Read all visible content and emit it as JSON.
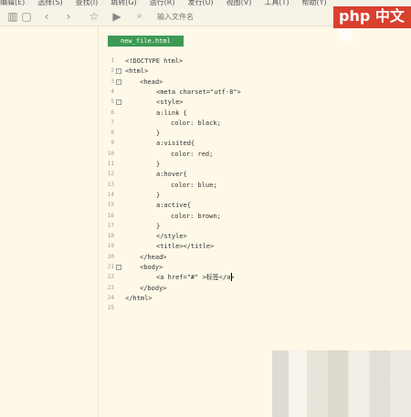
{
  "menubar": [
    "编辑(E)",
    "选择(S)",
    "查找(I)",
    "跳转(G)",
    "运行(R)",
    "发行(U)",
    "视图(V)",
    "工具(T)",
    "帮助(Y)"
  ],
  "toolbar": {
    "search_placeholder": "输入文件名"
  },
  "logo": "php 中文网",
  "tab": {
    "label": "new_file.html"
  },
  "lines": [
    {
      "n": "1",
      "text": "<!DOCTYPE html>",
      "indent": 0,
      "fold": ""
    },
    {
      "n": "2",
      "text": "<html>",
      "indent": 0,
      "fold": "-"
    },
    {
      "n": "3",
      "text": "<head>",
      "indent": 1,
      "fold": "-"
    },
    {
      "n": "4",
      "text": "<meta charset=\"utf-8\">",
      "indent": 2,
      "fold": ""
    },
    {
      "n": "5",
      "text": "<style>",
      "indent": 2,
      "fold": "-"
    },
    {
      "n": "6",
      "text": "a:link {",
      "indent": 2,
      "fold": ""
    },
    {
      "n": "7",
      "text": "color: black;",
      "indent": 3,
      "fold": ""
    },
    {
      "n": "8",
      "text": "}",
      "indent": 2,
      "fold": ""
    },
    {
      "n": "9",
      "text": "a:visited{",
      "indent": 2,
      "fold": ""
    },
    {
      "n": "10",
      "text": "color: red;",
      "indent": 3,
      "fold": ""
    },
    {
      "n": "11",
      "text": "}",
      "indent": 2,
      "fold": ""
    },
    {
      "n": "12",
      "text": "a:hover{",
      "indent": 2,
      "fold": ""
    },
    {
      "n": "13",
      "text": "color: blue;",
      "indent": 3,
      "fold": ""
    },
    {
      "n": "14",
      "text": "}",
      "indent": 2,
      "fold": ""
    },
    {
      "n": "15",
      "text": "a:active{",
      "indent": 2,
      "fold": ""
    },
    {
      "n": "16",
      "text": "color: brown;",
      "indent": 3,
      "fold": ""
    },
    {
      "n": "17",
      "text": "}",
      "indent": 2,
      "fold": ""
    },
    {
      "n": "18",
      "text": "</style>",
      "indent": 2,
      "fold": ""
    },
    {
      "n": "19",
      "text": "<title></title>",
      "indent": 2,
      "fold": ""
    },
    {
      "n": "20",
      "text": "</head>",
      "indent": 1,
      "fold": ""
    },
    {
      "n": "21",
      "text": "<body>",
      "indent": 1,
      "fold": "-"
    },
    {
      "n": "22",
      "text": "<a href=\"#\" >标签</a>",
      "indent": 2,
      "fold": ""
    },
    {
      "n": "23",
      "text": "</body>",
      "indent": 1,
      "fold": ""
    },
    {
      "n": "24",
      "text": "</html>",
      "indent": 0,
      "fold": ""
    },
    {
      "n": "25",
      "text": "",
      "indent": 0,
      "fold": ""
    }
  ],
  "colors": {
    "tab_bg": "#3c9a54",
    "editor_bg": "#fdf8e7"
  }
}
